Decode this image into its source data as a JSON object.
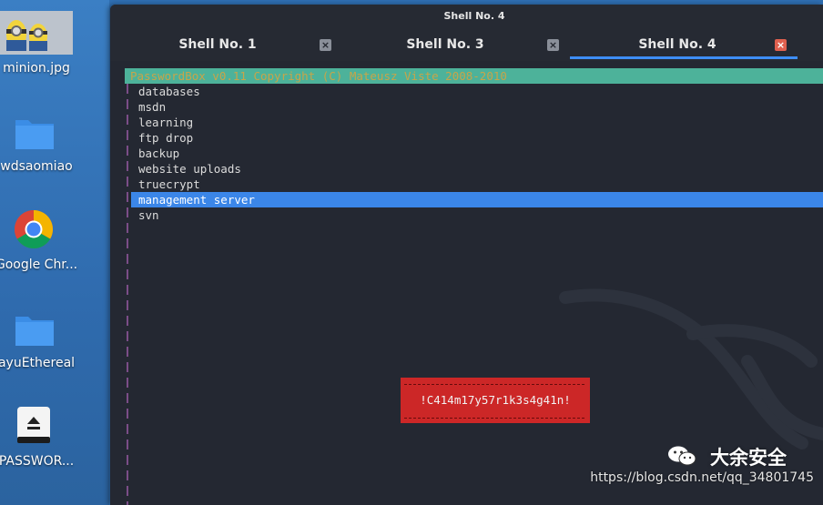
{
  "desktop": {
    "icons": [
      {
        "label": "minion.jpg",
        "icon": "image-file-icon"
      },
      {
        "label": "wdsaomiao",
        "icon": "folder-icon"
      },
      {
        "label": "Google Chr...",
        "icon": "chrome-icon"
      },
      {
        "label": "ayuEthereal",
        "icon": "folder-icon"
      },
      {
        "label": "PASSWOR...",
        "icon": "drive-icon"
      }
    ]
  },
  "window": {
    "title": "Shell No. 4",
    "tabs": [
      {
        "label": "Shell No. 1",
        "active": false
      },
      {
        "label": "Shell No. 3",
        "active": false
      },
      {
        "label": "Shell No. 4",
        "active": true
      }
    ],
    "close_glyph": "×"
  },
  "terminal": {
    "header": "PasswordBox v0.11 Copyright (C) Mateusz Viste 2008-2010",
    "items": [
      "databases",
      "msdn",
      "learning",
      "ftp drop",
      "backup",
      "website uploads",
      "truecrypt",
      "management server",
      "svn"
    ],
    "selected_index": 7,
    "password_dialog": "!C414m17y57r1k3s4g41n!"
  },
  "watermark": {
    "title": "大余安全",
    "url": "https://blog.csdn.net/qq_34801745"
  },
  "colors": {
    "accent": "#3e8ef7",
    "header_bg": "#4db29a",
    "header_text": "#c7a54a",
    "dialog_bg": "#cc2727"
  }
}
